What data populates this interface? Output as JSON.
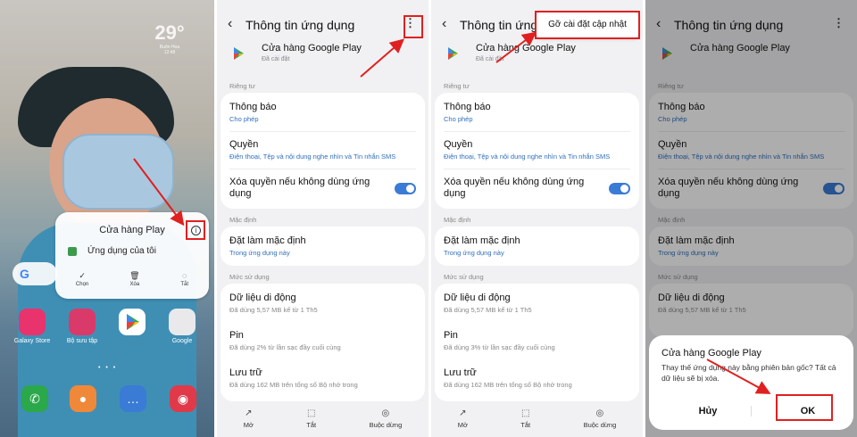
{
  "colors": {
    "accent": "#2f6fbe",
    "toggle": "#3a7bd5",
    "annotation": "#e02020"
  },
  "home": {
    "temperature": "29°",
    "location": "Buôn Hoa",
    "time_small": "12:48",
    "popup": {
      "title": "Cửa hàng Play",
      "item": "Ứng dụng của tôi",
      "actions": [
        "Chọn",
        "Xóa",
        "Tắt"
      ]
    },
    "apps": {
      "galaxy_store": "Galaxy Store",
      "gallery": "Bộ sưu tập",
      "google": "Google"
    }
  },
  "settings": {
    "title": "Thông tin ứng dụng",
    "title_truncated": "Thông tin ứng",
    "app_name": "Cửa hàng Google Play",
    "app_status": "Đã cài đặt",
    "section_privacy": "Riêng tư",
    "notifications": "Thông báo",
    "notifications_sub": "Cho phép",
    "permissions": "Quyền",
    "permissions_sub": "Điện thoại, Tệp và nội dung nghe nhìn và Tin nhắn SMS",
    "remove_perms": "Xóa quyền nếu không dùng ứng dụng",
    "section_default": "Mặc định",
    "set_default": "Đặt làm mặc định",
    "set_default_sub": "Trong ứng dụng này",
    "section_usage": "Mức sử dụng",
    "mobile_data": "Dữ liệu di động",
    "mobile_data_sub": "Đã dùng 5,57 MB kể từ 1 Th5",
    "battery": "Pin",
    "battery_sub_a": "Đã dùng 2% từ lần sạc đầy cuối cùng",
    "battery_sub_b": "Đã dùng 3% từ lần sạc đầy cuối cùng",
    "storage": "Lưu trữ",
    "storage_sub": "Đã dùng 162 MB trên tổng số Bộ nhớ trong",
    "bottom": {
      "open": "Mở",
      "disable": "Tắt",
      "force_stop": "Buộc dừng"
    },
    "uninstall_updates": "Gỡ cài đặt cập nhật"
  },
  "dialog": {
    "title": "Cửa hàng Google Play",
    "message": "Thay thế ứng dụng này bằng phiên bản gốc? Tất cả dữ liệu sẽ bị xóa.",
    "cancel": "Hủy",
    "ok": "OK"
  }
}
